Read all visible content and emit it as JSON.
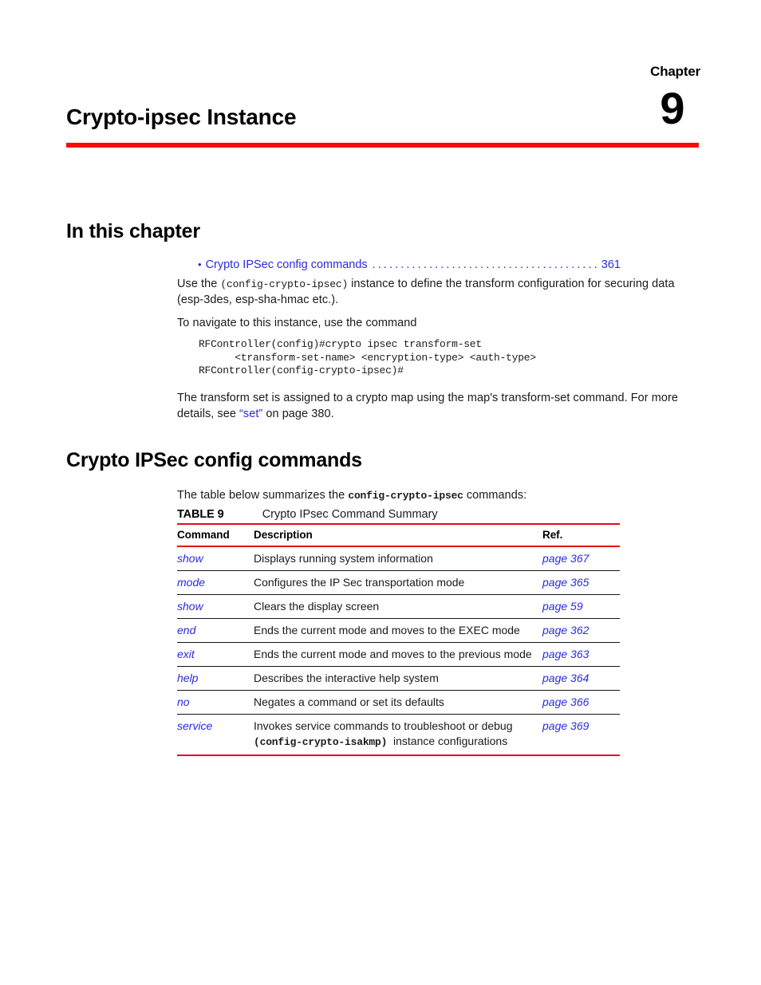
{
  "chapter": {
    "label": "Chapter",
    "number": "9",
    "title": "Crypto-ipsec Instance",
    "rule_color": "#fa0a05"
  },
  "sections": {
    "in_this_chapter": {
      "heading": "In this chapter",
      "toc": {
        "bullet": "•",
        "label": "Crypto IPSec config commands",
        "leader": "...................................................",
        "page": "361",
        "link_color": "#2a2ae0"
      },
      "para_use_the": {
        "before": "Use the",
        "code": "(config-crypto-ipsec)",
        "after": "instance to define the transform configuration for securing data (esp-3des, esp-sha-hmac etc.)."
      },
      "para_navigate": "To navigate to this instance, use the command",
      "code_block": "RFController(config)#crypto ipsec transform-set\n      <transform-set-name> <encryption-type> <auth-type>\nRFController(config-crypto-ipsec)#",
      "para_transform_set": {
        "before": "The transform set is assigned to a crypto map using the map's transform-set command. For more details, see",
        "link": "“set”",
        "after": "on page 380."
      }
    },
    "crypto_ipsec_config": {
      "heading": "Crypto IPSec config commands",
      "para_table_below": {
        "before": "The table below summarizes the",
        "code": "config-crypto-ipsec",
        "after": "commands:"
      },
      "table_caption": {
        "label": "TABLE 9",
        "title": "Crypto IPsec Command Summary"
      }
    }
  },
  "table": {
    "headers": [
      "Command",
      "Description",
      "Ref."
    ],
    "rule_color": "#e8071e",
    "rows": [
      {
        "command": "show",
        "description": "Displays running system information",
        "description_line2": "",
        "description_code": "",
        "ref": "page 367"
      },
      {
        "command": "mode",
        "description": "Configures the IP Sec transportation mode",
        "description_line2": "",
        "description_code": "",
        "ref": "page 365"
      },
      {
        "command": "show",
        "description": "Clears the display screen",
        "description_line2": "",
        "description_code": "",
        "ref": "page 59"
      },
      {
        "command": "end",
        "description": "Ends the current mode and moves to the EXEC mode",
        "description_line2": "",
        "description_code": "",
        "ref": "page 362"
      },
      {
        "command": "exit",
        "description": "Ends the current mode and moves to the previous mode",
        "description_line2": "",
        "description_code": "",
        "ref": "page 363"
      },
      {
        "command": "help",
        "description": "Describes the interactive help system",
        "description_line2": "",
        "description_code": "",
        "ref": "page 364"
      },
      {
        "command": "no",
        "description": "Negates a command or set its defaults",
        "description_line2": "",
        "description_code": "",
        "ref": "page 366"
      },
      {
        "command": "service",
        "description": "Invokes service commands to troubleshoot or debug",
        "description_code": "(config-crypto-isakmp)",
        "description_line2": "instance configurations",
        "ref": "page 369"
      }
    ]
  }
}
